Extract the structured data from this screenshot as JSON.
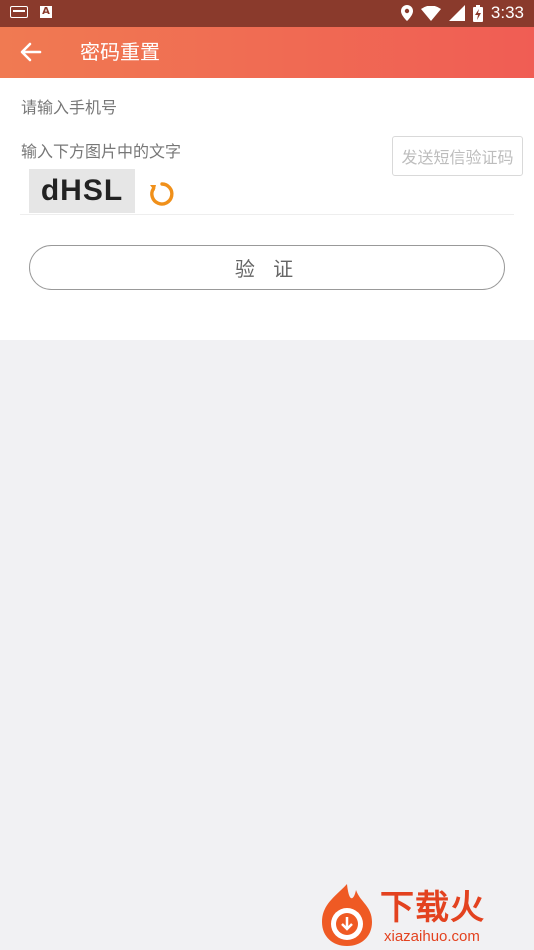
{
  "statusbar": {
    "time": "3:33"
  },
  "appbar": {
    "title": "密码重置"
  },
  "form": {
    "phone_placeholder": "请输入手机号",
    "captcha_placeholder": "输入下方图片中的文字",
    "sms_button": "发送短信验证码",
    "captcha_text": "dHSL",
    "verify_button": "验 证"
  },
  "watermark": {
    "name": "下载火",
    "url": "xiazaihuo.com"
  },
  "colors": {
    "statusbar": "#8a3a2c",
    "appbar_start": "#f07a52",
    "appbar_end": "#f05d54",
    "refresh": "#f0901a",
    "watermark": "#e3421f",
    "background": "#f1f1f3"
  }
}
